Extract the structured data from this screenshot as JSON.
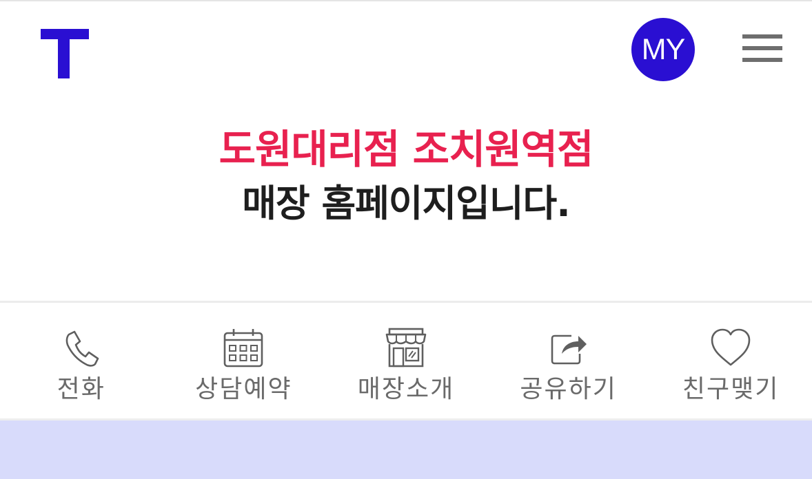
{
  "header": {
    "my_label": "MY",
    "logo_icon": "t-logo-icon",
    "menu_icon": "hamburger-menu-icon"
  },
  "hero": {
    "store_name": "도원대리점 조치원역점",
    "subtitle": "매장 홈페이지입니다."
  },
  "quick_menu": {
    "items": [
      {
        "label": "전화",
        "icon": "phone-icon"
      },
      {
        "label": "상담예약",
        "icon": "calendar-icon"
      },
      {
        "label": "매장소개",
        "icon": "store-icon"
      },
      {
        "label": "공유하기",
        "icon": "share-icon"
      },
      {
        "label": "친구맺기",
        "icon": "heart-icon"
      }
    ]
  },
  "colors": {
    "brand": "#2a0fd2",
    "accent_red": "#e8214f",
    "banner_bg": "#d8dbfb"
  }
}
